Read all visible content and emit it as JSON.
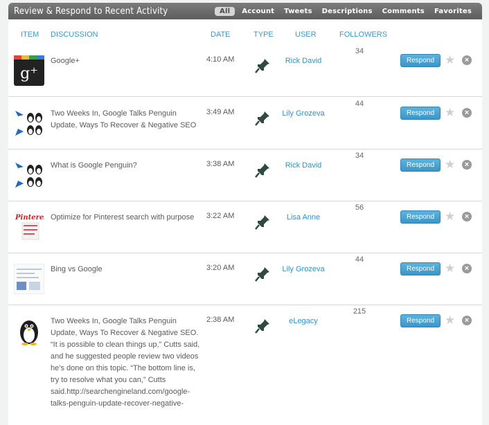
{
  "header": {
    "title": "Review & Respond to Recent Activity",
    "filters": [
      "All",
      "Account",
      "Tweets",
      "Descriptions",
      "Comments",
      "Favorites"
    ]
  },
  "columns": {
    "item": "ITEM",
    "discussion": "DISCUSSION",
    "date": "DATE",
    "type": "TYPE",
    "user": "USER",
    "followers": "FOLLOWERS"
  },
  "rows": [
    {
      "thumb_icon": "google-plus-icon",
      "discussion": "Google+",
      "date": "4:10 AM",
      "user": "Rick David",
      "followers": "34",
      "respond": "Respond"
    },
    {
      "thumb_icon": "penguin-update-icon",
      "discussion": "Two Weeks In, Google Talks Penguin Update, Ways To Recover & Negative SEO",
      "date": "3:49 AM",
      "user": "Lily Grozeva",
      "followers": "44",
      "respond": "Respond"
    },
    {
      "thumb_icon": "penguin-update-icon",
      "discussion": "What is Google Penguin?",
      "date": "3:38 AM",
      "user": "Rick David",
      "followers": "34",
      "respond": "Respond"
    },
    {
      "thumb_icon": "pinterest-icon",
      "discussion": "Optimize for Pinterest search with purpose",
      "date": "3:22 AM",
      "user": "Lisa Anne",
      "followers": "56",
      "respond": "Respond"
    },
    {
      "thumb_icon": "bing-vs-google-icon",
      "discussion": "Bing vs Google",
      "date": "3:20 AM",
      "user": "Lily Grozeva",
      "followers": "44",
      "respond": "Respond"
    },
    {
      "thumb_icon": "penguin-icon",
      "discussion": "Two Weeks In, Google Talks Penguin Update, Ways To Recover & Negative SEO. “It is possible to clean things up,” Cutts said, and he suggested people review two videos he’s done on this topic. “The bottom line is, try to resolve what you can,” Cutts said.http://searchengineland.com/google-talks-penguin-update-recover-negative-",
      "date": "2:38 AM",
      "user": "eLegacy",
      "followers": "215",
      "respond": "Respond"
    }
  ]
}
